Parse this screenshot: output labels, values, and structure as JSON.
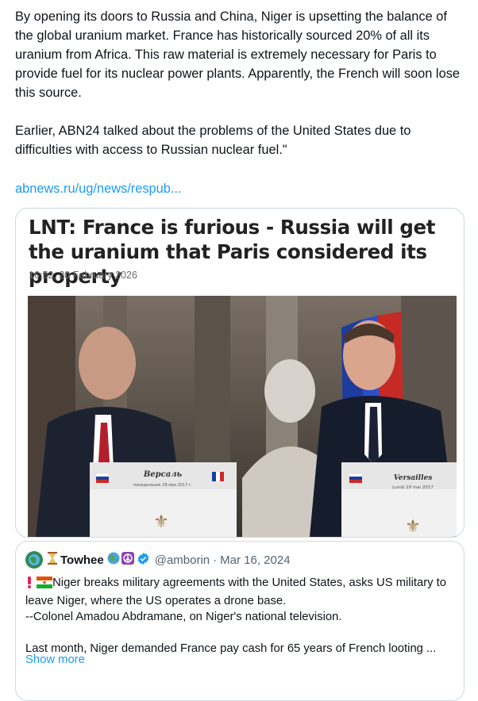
{
  "post": {
    "text": "By opening its doors to Russia and China, Niger is upsetting the balance of the global uranium market. France has historically sourced 20% of all its uranium from Africa. This raw material is extremely necessary for Paris to provide fuel for its nuclear power plants. Apparently, the French will soon lose this source.\n\nEarlier, ABN24 talked about the problems of the United States due to difficulties with access to Russian nuclear fuel.\"",
    "link": "abnews.ru/ug/news/respub..."
  },
  "article": {
    "title": "LNT: France is furious - Russia will get the uranium that Paris considered its property",
    "date": "16:52, 20 February 2026",
    "left_podium_title": "Версаль",
    "left_podium_sub": "понедельник 29 мая 2017 г.",
    "right_podium_title": "Versailles",
    "right_podium_sub": "Lundi 29 mai 2017"
  },
  "quote": {
    "name": "Towhee",
    "handle": "@amborin",
    "date": "Mar 16, 2024",
    "body": "Niger breaks military agreements with the United States, asks US military to leave Niger, where the US operates a drone base.\n--Colonel Amadou Abdramane, on Niger's national television.\n\nLast month, Niger demanded France pay cash for 65 years of French looting ...",
    "show_more": "Show more"
  },
  "colors": {
    "link": "#1d9bf0",
    "border": "#cfd9de",
    "verified": "#1d9bf0"
  },
  "icons": [
    "globe-emoji-icon",
    "hourglass-emoji-icon",
    "earth-emoji-icon",
    "peace-emoji-icon",
    "verified-badge-icon",
    "exclamation-icon",
    "niger-flag-icon"
  ]
}
